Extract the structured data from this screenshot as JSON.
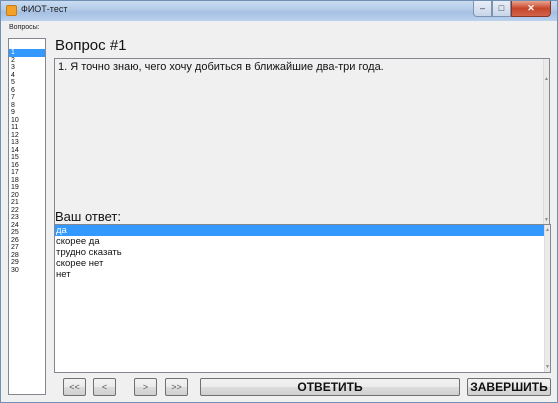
{
  "window": {
    "title": "ФИОТ-тест",
    "controls": [
      "–",
      "□",
      "✕"
    ]
  },
  "sidebar": {
    "label": "Вопросы:",
    "items": [
      "1",
      "2",
      "3",
      "4",
      "5",
      "6",
      "7",
      "8",
      "9",
      "10",
      "11",
      "12",
      "13",
      "14",
      "15",
      "16",
      "17",
      "18",
      "19",
      "20",
      "21",
      "22",
      "23",
      "24",
      "25",
      "26",
      "27",
      "28",
      "29",
      "30"
    ],
    "selected": "1"
  },
  "question": {
    "title": "Вопрос #1",
    "text": "1. Я точно знаю, чего хочу добиться в ближайшие два-три года."
  },
  "answer": {
    "title": "Ваш ответ:",
    "options": [
      "да",
      "скорее да",
      "трудно сказать",
      "скорее нет",
      "нет"
    ],
    "selected": "да"
  },
  "nav": {
    "first": "<<",
    "prev": "<",
    "next": ">",
    "last": ">>",
    "answer": "ОТВЕТИТЬ",
    "finish": "ЗАВЕРШИТЬ"
  },
  "colors": {
    "selection": "#3399ff",
    "titlebar": "#b3cbe8",
    "background": "#f0f0f0"
  }
}
